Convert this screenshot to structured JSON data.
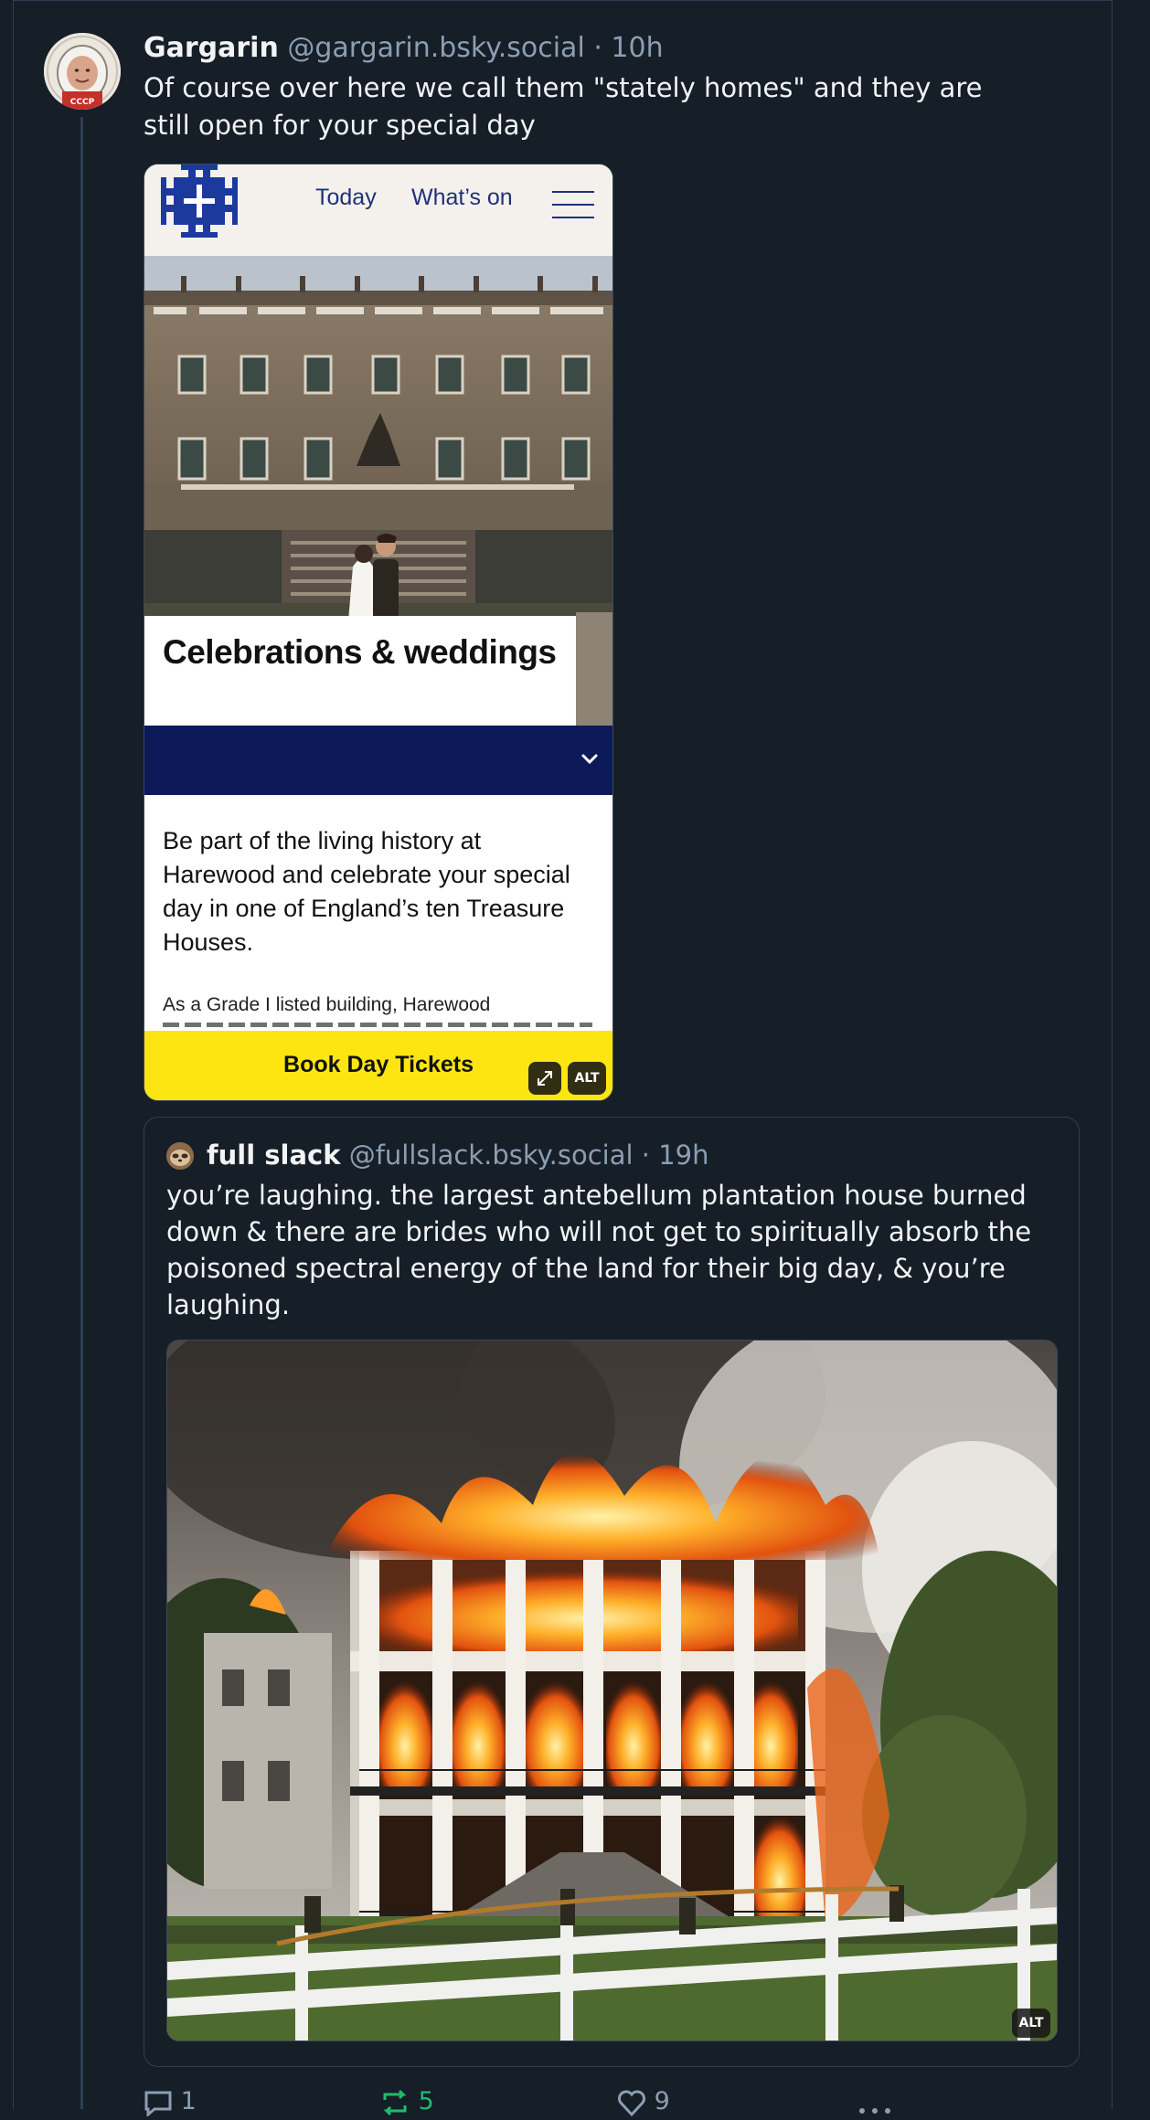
{
  "post": {
    "author_name": "Gargarin",
    "author_handle": "@gargarin.bsky.social",
    "separator": "·",
    "time": "10h",
    "text": "Of course over here we call them \"stately homes\" and they are still open for your special day",
    "image": {
      "nav_today": "Today",
      "nav_whats_on": "What’s on",
      "hero_title": "Celebrations & weddings",
      "body_text": "Be part of the living history at Harewood and celebrate your special day in one of England’s ten Treasure Houses.",
      "small_text": "As a Grade I listed building, Harewood",
      "cta_label": "Book Day Tickets",
      "alt_label": "ALT",
      "icons": [
        "harewood-logo-icon",
        "menu-icon",
        "chevron-down-icon",
        "expand-icon"
      ],
      "colors": {
        "nav_text": "#21317a",
        "hero_bar": "#0c1a5a",
        "cta_bg": "#fde511"
      }
    }
  },
  "quote": {
    "author_name": "full slack",
    "author_handle": "@fullslack.bsky.social",
    "separator": "·",
    "time": "19h",
    "text": "you’re laughing. the largest antebellum plantation house burned down & there are brides who will not get to spiritually absorb the poisoned spectral energy of the land for their big day, & you’re laughing.",
    "alt_label": "ALT"
  },
  "actions": {
    "reply_count": "1",
    "repost_count": "5",
    "like_count": "9",
    "icons": [
      "reply-icon",
      "repost-icon",
      "like-icon",
      "more-icon"
    ],
    "colors": {
      "repost_active": "#20bc6e",
      "muted": "#8c9eb2"
    }
  },
  "theme": {
    "background": "#161e27",
    "border": "#2e4052",
    "text": "#f1f3f5",
    "muted": "#8c9eb2"
  }
}
